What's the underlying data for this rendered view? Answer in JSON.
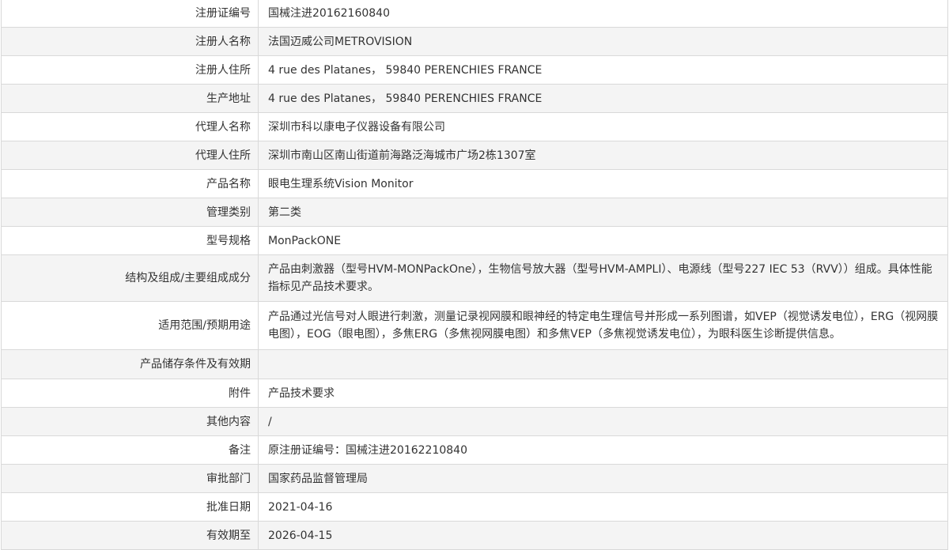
{
  "rows": [
    {
      "label": "注册证编号",
      "value": "国械注进20162160840"
    },
    {
      "label": "注册人名称",
      "value": "法国迈威公司METROVISION"
    },
    {
      "label": "注册人住所",
      "value": "4 rue des Platanes， 59840 PERENCHIES FRANCE"
    },
    {
      "label": "生产地址",
      "value": "4 rue des Platanes， 59840 PERENCHIES FRANCE"
    },
    {
      "label": "代理人名称",
      "value": "深圳市科以康电子仪器设备有限公司"
    },
    {
      "label": "代理人住所",
      "value": "深圳市南山区南山街道前海路泛海城市广场2栋1307室"
    },
    {
      "label": "产品名称",
      "value": "眼电生理系统Vision Monitor"
    },
    {
      "label": "管理类别",
      "value": "第二类"
    },
    {
      "label": "型号规格",
      "value": "MonPackONE"
    },
    {
      "label": "结构及组成/主要组成成分",
      "value": "产品由刺激器（型号HVM-MONPackOne），生物信号放大器（型号HVM-AMPLI）、电源线（型号227 IEC 53（RVV））组成。具体性能指标见产品技术要求。"
    },
    {
      "label": "适用范围/预期用途",
      "value": "产品通过光信号对人眼进行刺激，测量记录视网膜和眼神经的特定电生理信号并形成一系列图谱，如VEP（视觉诱发电位），ERG（视网膜电图），EOG（眼电图），多焦ERG（多焦视网膜电图）和多焦VEP（多焦视觉诱发电位），为眼科医生诊断提供信息。"
    },
    {
      "label": "产品储存条件及有效期",
      "value": ""
    },
    {
      "label": "附件",
      "value": "产品技术要求"
    },
    {
      "label": "其他内容",
      "value": "/"
    },
    {
      "label": "备注",
      "value": "原注册证编号：国械注进20162210840"
    },
    {
      "label": "审批部门",
      "value": "国家药品监督管理局"
    },
    {
      "label": "批准日期",
      "value": "2021-04-16"
    },
    {
      "label": "有效期至",
      "value": "2026-04-15"
    }
  ]
}
